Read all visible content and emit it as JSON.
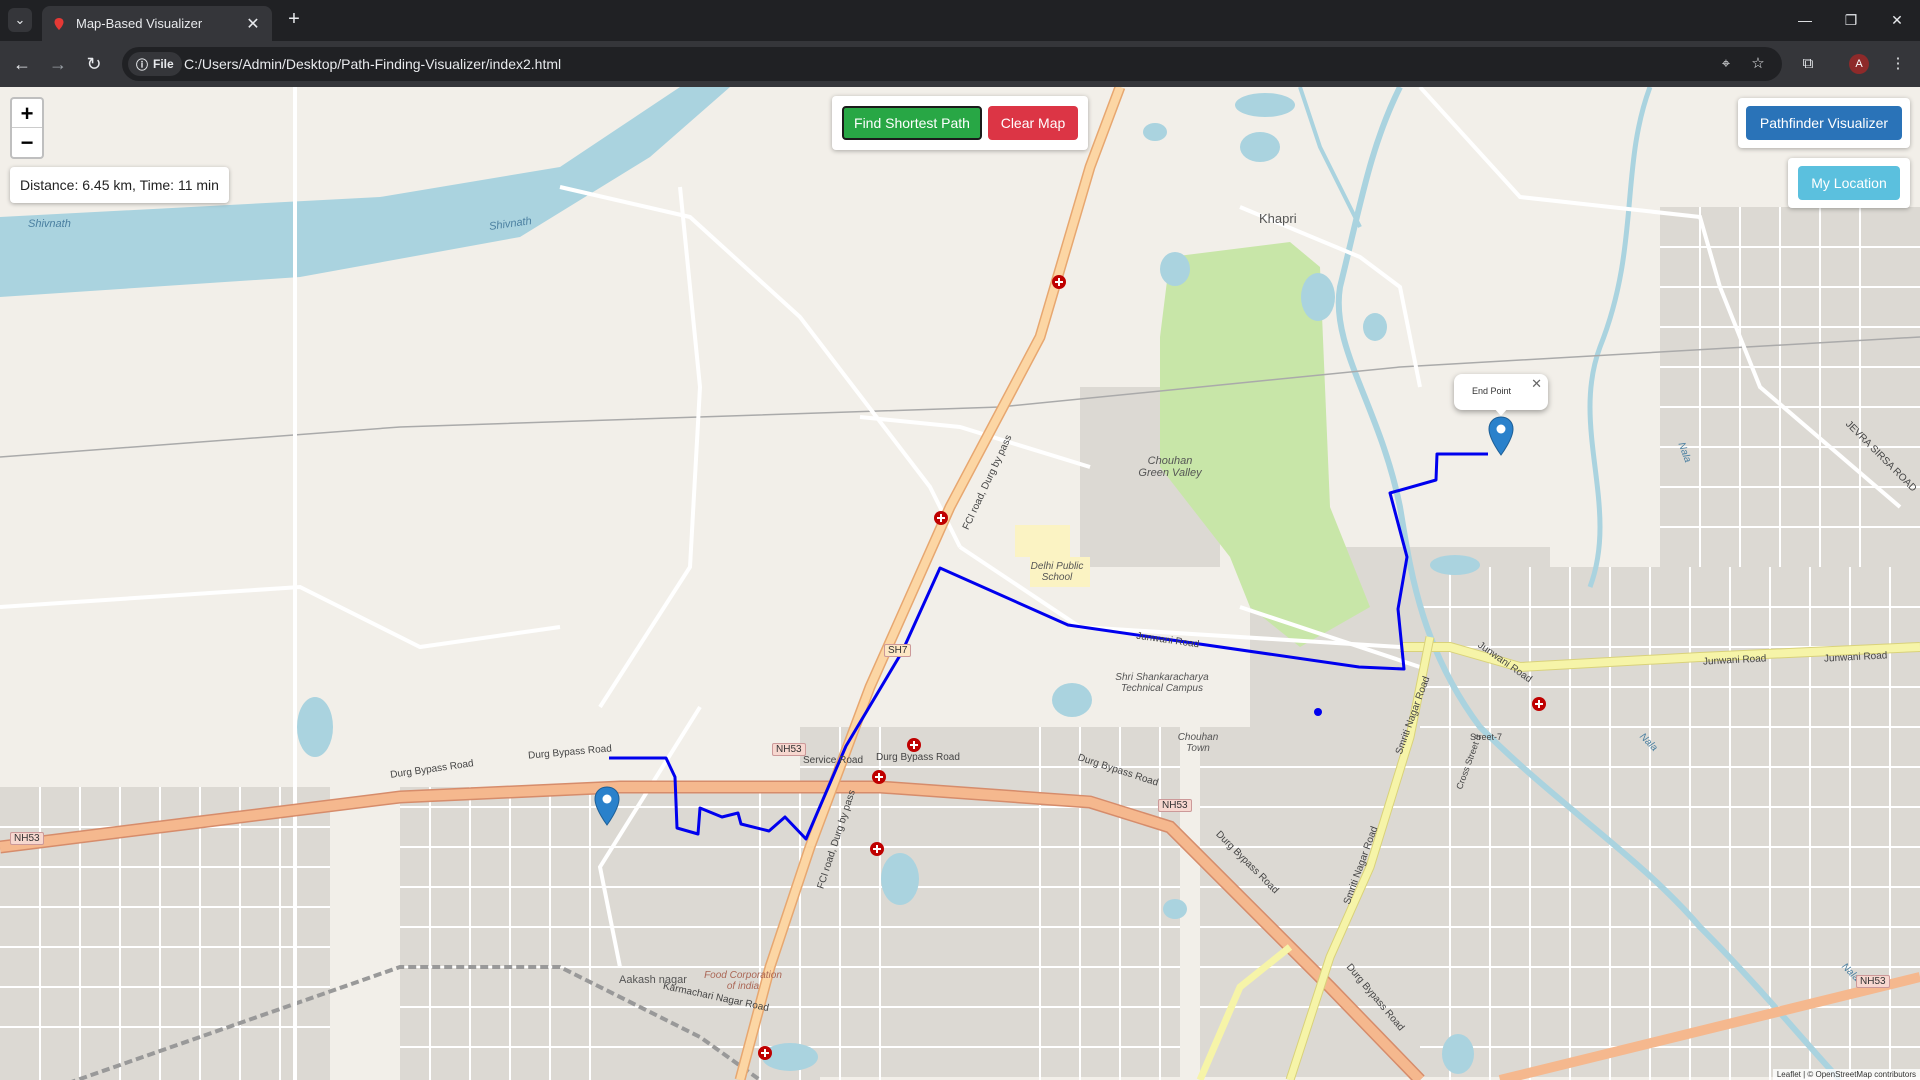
{
  "browser": {
    "tab_title": "Map-Based Visualizer",
    "site_chip": "File",
    "url": "C:/Users/Admin/Desktop/Path-Finding-Visualizer/index2.html",
    "profile_initial": "A"
  },
  "controls": {
    "find_label": "Find Shortest Path",
    "clear_label": "Clear Map",
    "visualizer_label": "Pathfinder Visualizer",
    "location_label": "My Location",
    "zoom_in": "+",
    "zoom_out": "−"
  },
  "info": {
    "distance_time": "Distance: 6.45 km, Time: 11 min"
  },
  "popup": {
    "text": "End Point"
  },
  "map_labels": {
    "shivnath_1": "Shivnath",
    "shivnath_2": "Shivnath",
    "khapri": "Khapri",
    "chouhan_green_valley": "Chouhan Green Valley",
    "delhi_public_school": "Delhi Public School",
    "shankaracharya": "Shri Shankaracharya Technical Campus",
    "chouhan_town": "Chouhan Town",
    "aakash_nagar": "Aakash nagar",
    "food_corporation": "Food Corporation of india",
    "karmachari": "Karmachari Nagar Road",
    "fci_road_1": "FCI road, Durg by pass",
    "fci_road_2": "FCI road, Durg by pass",
    "durg_bypass_1": "Durg Bypass Road",
    "durg_bypass_2": "Durg Bypass Road",
    "durg_bypass_3": "Durg Bypass Road",
    "durg_bypass_4": "Durg Bypass Road",
    "durg_bypass_5": "Durg Bypass Road",
    "durg_bypass_6": "Durg Bypass Road",
    "service_road": "Service Road",
    "junwani_1": "Junwani Road",
    "junwani_2": "Junwani Road",
    "junwani_3": "Junwani Road",
    "junwani_4": "Junwani Road",
    "smriti_1": "Smriti Nagar Road",
    "smriti_2": "Smriti Nagar Road",
    "jevra": "JEVRA SIRSA ROAD",
    "nala_1": "Nala",
    "nala_2": "Nala",
    "nala_3": "Nala",
    "street7": "Street-7",
    "cross_street": "Cross Street 5",
    "nh53_1": "NH53",
    "nh53_2": "NH53",
    "nh53_3": "NH53",
    "nh53_4": "NH53",
    "sh7": "SH7"
  },
  "attribution": "Leaflet | © OpenStreetMap contributors",
  "colors": {
    "route": "#0000ee",
    "find_button": "#28a745",
    "clear_button": "#dc3545",
    "visualizer_button": "#2a73b8",
    "location_button": "#5bc0de",
    "water": "#aad3df",
    "park": "#c8e6a8",
    "trunk_road": "#f5b88e",
    "primary_road": "#f6f4a8"
  },
  "icons": {
    "start_marker": "map-pin-icon",
    "end_marker": "map-pin-icon",
    "hospital": "hospital-cross-icon"
  }
}
